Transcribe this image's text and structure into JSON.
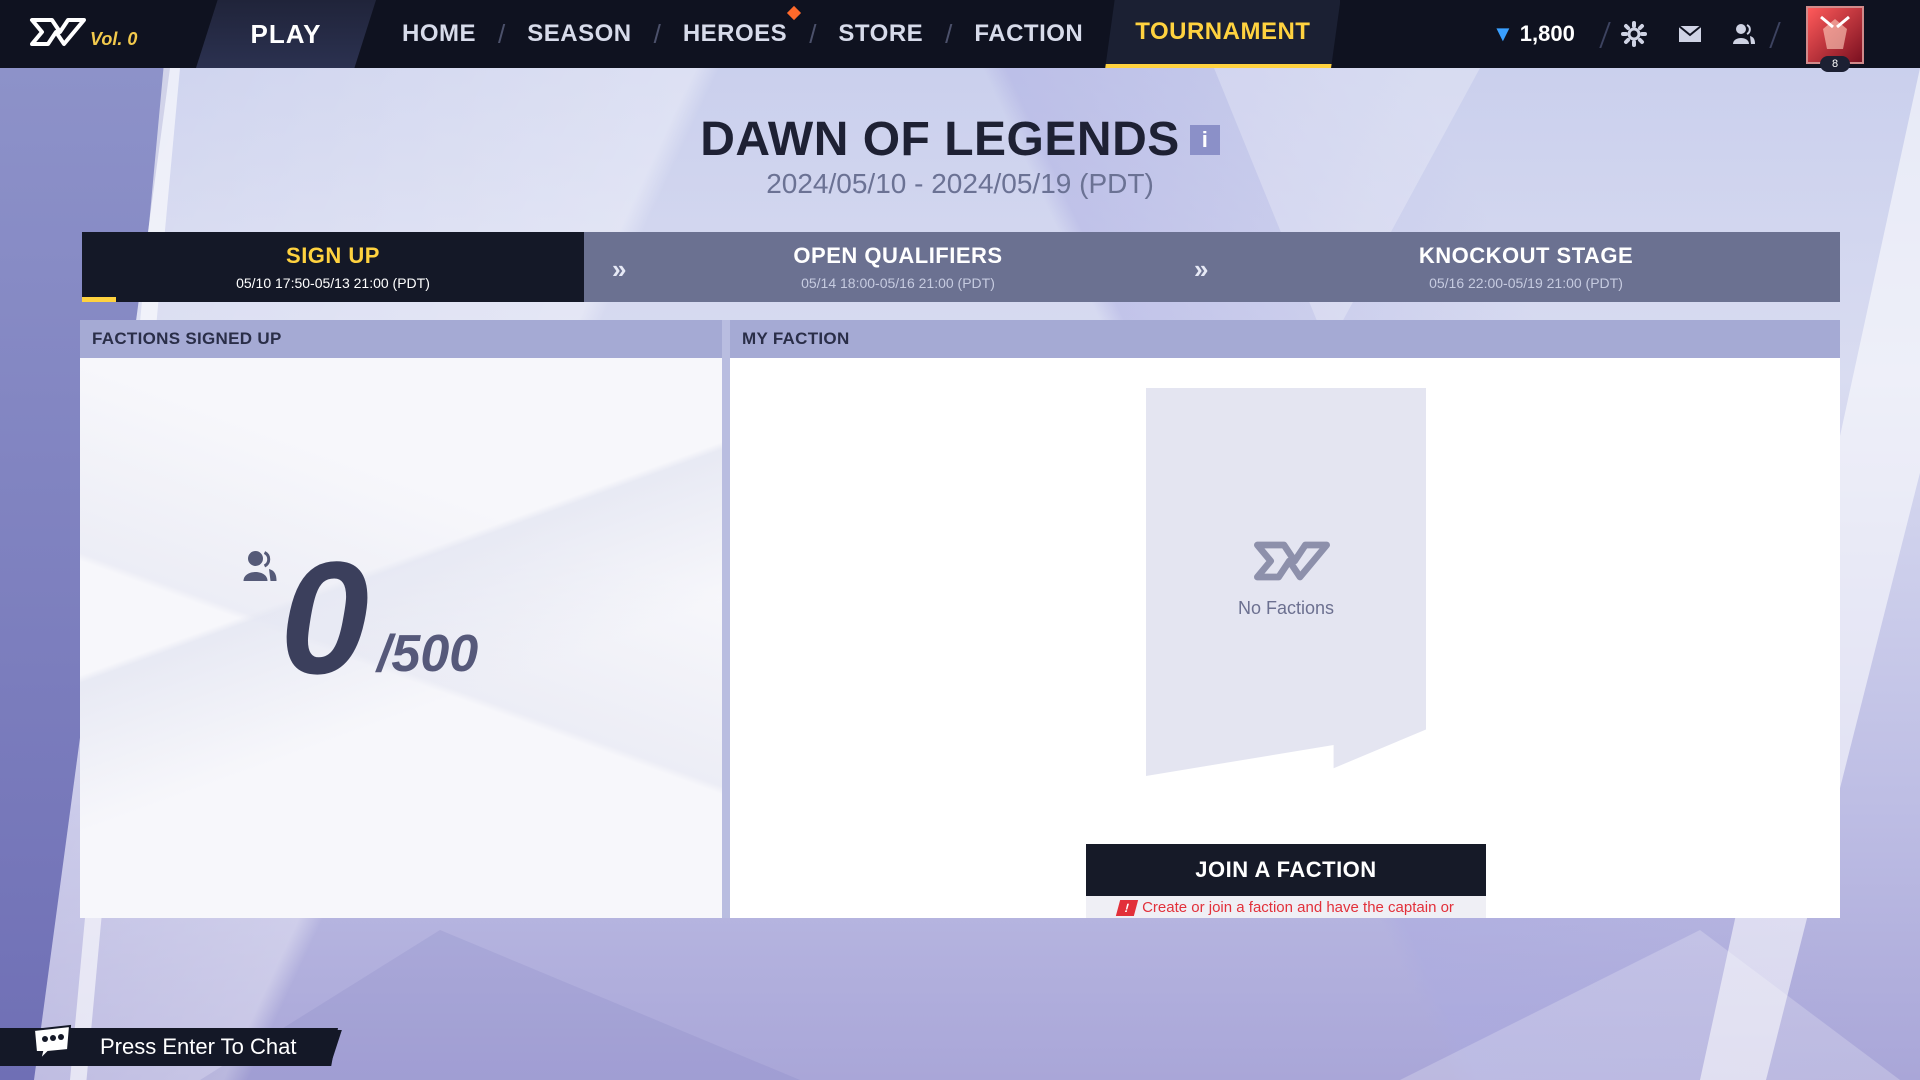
{
  "topbar": {
    "logo_vol": "Vol. 0",
    "play": "PLAY",
    "nav": [
      {
        "label": "HOME"
      },
      {
        "label": "SEASON"
      },
      {
        "label": "HEROES"
      },
      {
        "label": "STORE"
      },
      {
        "label": "FACTION"
      },
      {
        "label": "TOURNAMENT"
      }
    ],
    "active_tab": "TOURNAMENT",
    "currency_value": "1,800",
    "avatar_level": "8",
    "accent_color": "#ffd23f"
  },
  "event": {
    "title": "DAWN OF LEGENDS",
    "info_icon": "i",
    "dates": "2024/05/10 - 2024/05/19 (PDT)"
  },
  "stages": [
    {
      "title": "SIGN UP",
      "time": "05/10 17:50-05/13 21:00 (PDT)",
      "current": true
    },
    {
      "title": "OPEN QUALIFIERS",
      "time": "05/14 18:00-05/16 21:00 (PDT)",
      "current": false
    },
    {
      "title": "KNOCKOUT STAGE",
      "time": "05/16 22:00-05/19 21:00 (PDT)",
      "current": false
    }
  ],
  "left_panel": {
    "header": "FACTIONS SIGNED UP",
    "count": "0",
    "total": "/500"
  },
  "right_panel": {
    "header": "MY FACTION",
    "empty_text": "No Factions",
    "join_button": "JOIN A FACTION",
    "join_note": "Create or join a faction and have the captain or coach sign up."
  },
  "chat": {
    "placeholder": "Press Enter To Chat"
  },
  "icons": [
    "game-logo-icon",
    "currency-icon",
    "settings-icon",
    "mail-icon",
    "friends-icon",
    "info-icon",
    "chevron-right-icon",
    "users-icon",
    "warning-icon",
    "chat-icon"
  ]
}
